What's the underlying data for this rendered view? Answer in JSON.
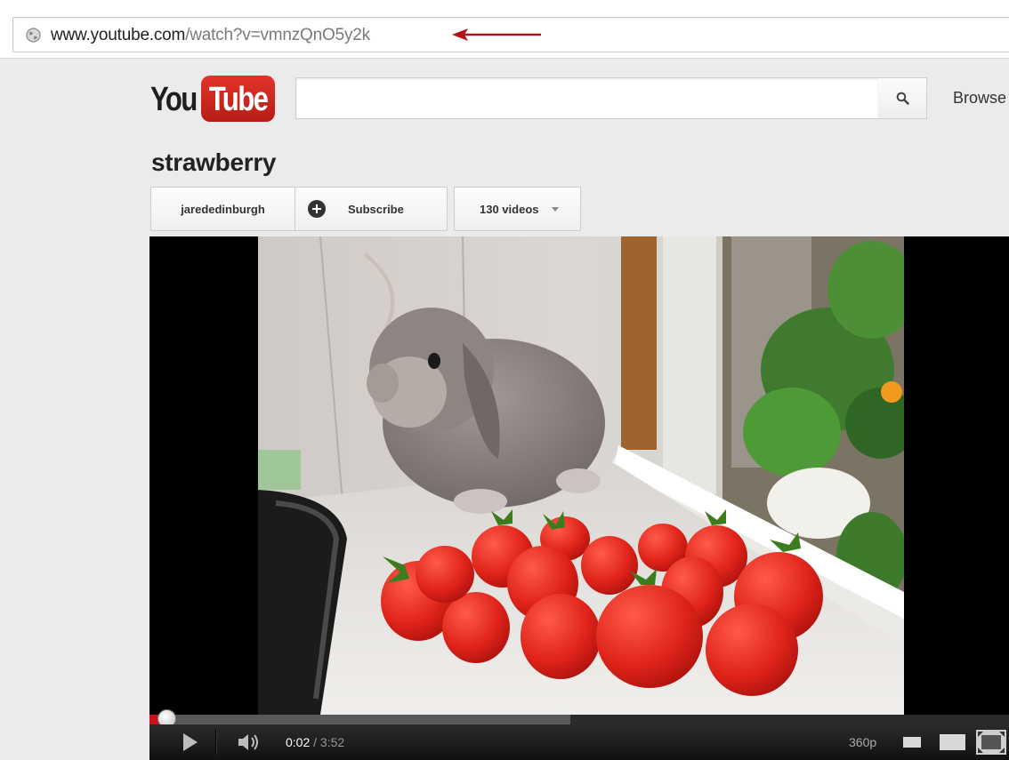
{
  "browser": {
    "url_host": "www.youtube.com",
    "url_path": "/watch?v=vmnzQnO5y2k"
  },
  "header": {
    "logo_you": "You",
    "logo_tube": "Tube",
    "search_placeholder": "",
    "browse_label": "Browse"
  },
  "video": {
    "title": "strawberry",
    "channel_name": "jarededinburgh",
    "subscribe_label": "Subscribe",
    "videos_label": "130 videos"
  },
  "player": {
    "current_time": "0:02",
    "time_separator": " / ",
    "duration": "3:52",
    "quality": "360p",
    "played_fraction": 0.02,
    "buffered_fraction": 0.49
  },
  "colors": {
    "brand_red": "#cc181e",
    "progress_red": "#c8111a",
    "annotation_arrow": "#b3141a"
  },
  "icons": {
    "address_bar": "globe-icon",
    "search": "magnifier-icon",
    "subscribe": "plus-circle-icon",
    "videos_dropdown": "caret-down-icon",
    "play": "play-icon",
    "volume": "speaker-icon",
    "size_small": "small-player-icon",
    "size_large": "large-player-icon",
    "fullscreen": "fullscreen-icon"
  }
}
